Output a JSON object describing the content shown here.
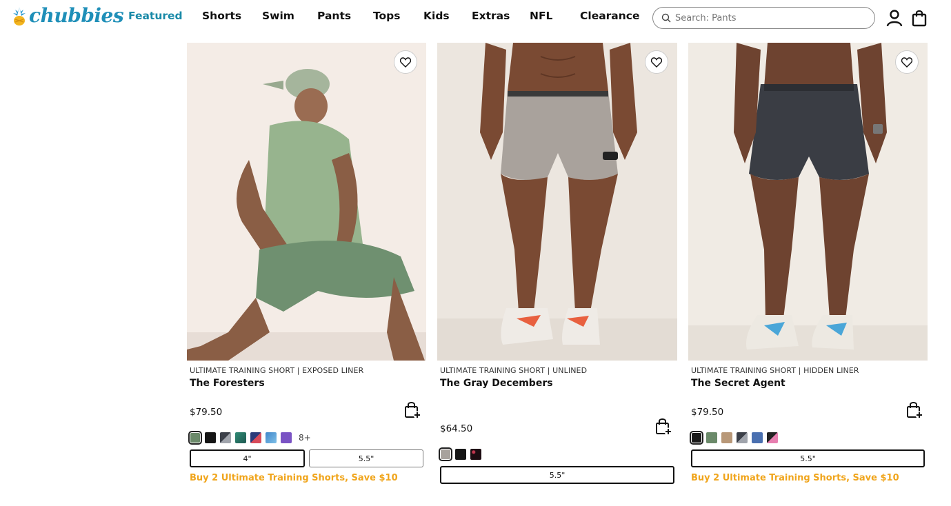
{
  "brand": {
    "name": "chubbies"
  },
  "nav": [
    {
      "label": "Featured",
      "active": true
    },
    {
      "label": "Shorts"
    },
    {
      "label": "Swim"
    },
    {
      "label": "Pants"
    },
    {
      "label": "Tops"
    },
    {
      "label": "Kids"
    },
    {
      "label": "Extras"
    },
    {
      "label": "NFL"
    },
    {
      "label": "Clearance"
    }
  ],
  "search": {
    "placeholder": "Search: Pants",
    "icon": "search-icon"
  },
  "header_icons": [
    "account-icon",
    "cart-bag-icon"
  ],
  "colors": {
    "brand": "#1f8fb8",
    "active_nav": "#1a8aa8",
    "promo": "#f0a51c"
  },
  "products": [
    {
      "subtitle": "ULTIMATE TRAINING SHORT | EXPOSED LINER",
      "title": "The Foresters",
      "price": "$79.50",
      "swatches": [
        "#6b8a6a",
        "#151515",
        "#6b6f78",
        "#2f8a74",
        "#2b3b7a",
        "#3f86c9",
        "#7a53c4"
      ],
      "more_colors": "8+",
      "sizes": [
        "4\"",
        "5.5\""
      ],
      "promo": "Buy 2 Ultimate Training Shorts, Save $10"
    },
    {
      "subtitle": "ULTIMATE TRAINING SHORT | UNLINED",
      "title": "The Gray Decembers",
      "price": "$64.50",
      "swatches": [
        "#a8a29d",
        "#151515",
        "#1d0d12"
      ],
      "sizes": [
        "5.5\""
      ]
    },
    {
      "subtitle": "ULTIMATE TRAINING SHORT | HIDDEN LINER",
      "title": "The Secret Agent",
      "price": "$79.50",
      "swatches": [
        "#1a1a1a",
        "#6b8a6a",
        "#b89878",
        "#6b6f78",
        "#4a70b0",
        "#e77fb0"
      ],
      "sizes": [
        "5.5\""
      ],
      "promo": "Buy 2 Ultimate Training Shorts, Save $10"
    }
  ]
}
